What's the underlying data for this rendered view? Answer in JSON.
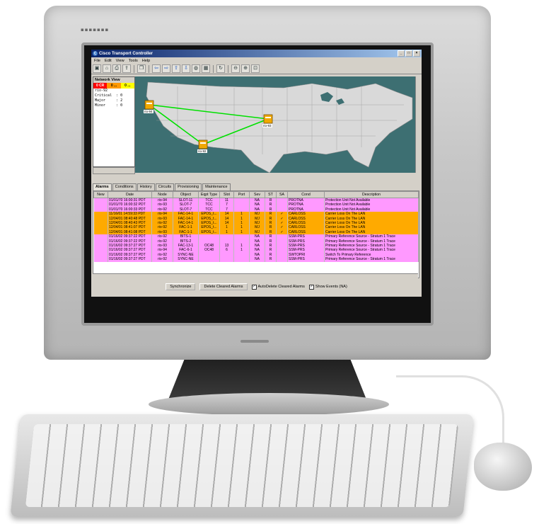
{
  "app": {
    "title": "Cisco Transport Controller",
    "window_controls": [
      "_",
      "□",
      "×"
    ]
  },
  "menu": [
    "File",
    "Edit",
    "View",
    "Tools",
    "Help"
  ],
  "network_view": {
    "title": "Network View",
    "severity": [
      {
        "label": "0 CR",
        "color": "#ff0000"
      },
      {
        "label": "0 ...",
        "color": "#ff9900"
      },
      {
        "label": "0 ...",
        "color": "#ffff00"
      }
    ],
    "lines": [
      "rio-92",
      "Critical  : 0",
      "Major     : 2",
      "Minor     : 0"
    ]
  },
  "map": {
    "water_color": "#3d6f72",
    "land_color": "#d9d9d9",
    "link_color": "#00e000",
    "nodes": [
      {
        "name": "rio-94"
      },
      {
        "name": "rio-93"
      },
      {
        "name": "rio-92"
      }
    ]
  },
  "tabs": [
    "Alarms",
    "Conditions",
    "History",
    "Circuits",
    "Provisioning",
    "Maintenance"
  ],
  "alarms": {
    "columns": [
      "New",
      "Date",
      "Node",
      "Object",
      "Eqpt Type",
      "Slot",
      "Port",
      "Sev",
      "ST",
      "SA",
      "Cond",
      "Description"
    ],
    "rows": [
      {
        "style": "pink",
        "cells": [
          "",
          "01/01/70 16:00:31 PDT",
          "rio-94",
          "SLOT-11",
          "TCC",
          "11",
          "",
          "NA",
          "R",
          "",
          "PROTNA",
          "Protection Unit Not Available"
        ]
      },
      {
        "style": "pink",
        "cells": [
          "",
          "01/01/70 16:00:32 PDT",
          "rio-93",
          "SLOT-7",
          "TCC",
          "7",
          "",
          "NA",
          "R",
          "",
          "PROTNA",
          "Protection Unit Not Available"
        ]
      },
      {
        "style": "pink",
        "cells": [
          "",
          "01/01/70 16:00:33 PDT",
          "rio-92",
          "SLOT-7",
          "TCC",
          "7",
          "",
          "NA",
          "R",
          "",
          "PROTNA",
          "Protection Unit Not Available"
        ]
      },
      {
        "style": "orange",
        "cells": [
          "",
          "11/16/01 14:59:33 PDT",
          "rio-94",
          "FAC-14-1",
          "EPOS_t...",
          "14",
          "1",
          "MJ",
          "R",
          "✓",
          "CARLOSS",
          "Carrier Loss On The LAN"
        ]
      },
      {
        "style": "orange",
        "cells": [
          "",
          "12/04/01 08:40:48 PDT",
          "rio-93",
          "FAC-14-1",
          "EPOS_t...",
          "14",
          "1",
          "MJ",
          "R",
          "✓",
          "CARLOSS",
          "Carrier Loss On The LAN"
        ]
      },
      {
        "style": "orange",
        "cells": [
          "",
          "12/04/01 08:40:43 PDT",
          "rio-92",
          "FAC-14-1",
          "EPOS_t...",
          "14",
          "1",
          "MJ",
          "R",
          "✓",
          "CARLOSS",
          "Carrier Loss On The LAN"
        ]
      },
      {
        "style": "orange",
        "cells": [
          "",
          "12/04/01 08:41:07 PDT",
          "rio-92",
          "FAC-1-1",
          "EPOS_t...",
          "1",
          "1",
          "MJ",
          "R",
          "✓",
          "CARLOSS",
          "Carrier Loss On The LAN"
        ]
      },
      {
        "style": "orange",
        "cells": [
          "",
          "12/04/01 08:41:08 PDT",
          "rio-93",
          "FAC-1-1",
          "EPOS_t...",
          "1",
          "1",
          "MJ",
          "R",
          "✓",
          "CARLOSS",
          "Carrier Loss On The LAN"
        ]
      },
      {
        "style": "pink",
        "cells": [
          "",
          "01/16/02 09:37:22 PDT",
          "rio-92",
          "BITS-1",
          "",
          "",
          "",
          "NA",
          "R",
          "",
          "SSM-PRS",
          "Primary Reference Source - Stratum 1 Trace"
        ]
      },
      {
        "style": "pink",
        "cells": [
          "",
          "01/16/02 09:37:22 PDT",
          "rio-92",
          "BITS-2",
          "",
          "",
          "",
          "NA",
          "R",
          "",
          "SSM-PRS",
          "Primary Reference Source - Stratum 1 Trace"
        ]
      },
      {
        "style": "pink",
        "cells": [
          "",
          "01/16/02 09:37:27 PDT",
          "rio-93",
          "FAC-13-1",
          "OC48",
          "13",
          "1",
          "NA",
          "R",
          "",
          "SSM-PRS",
          "Primary Reference Source - Stratum 1 Trace"
        ]
      },
      {
        "style": "pink",
        "cells": [
          "",
          "01/16/02 09:37:27 PDT",
          "rio-94",
          "FAC-6-1",
          "OC48",
          "6",
          "1",
          "NA",
          "R",
          "",
          "SSM-PRS",
          "Primary Reference Source - Stratum 1 Trace"
        ]
      },
      {
        "style": "pink",
        "cells": [
          "",
          "01/16/02 09:37:27 PDT",
          "rio-92",
          "SYNC-NE",
          "",
          "",
          "",
          "NA",
          "R",
          "",
          "SWTOPRI",
          "Switch To Primary Reference"
        ]
      },
      {
        "style": "pink",
        "cells": [
          "",
          "01/16/02 09:37:27 PDT",
          "rio-92",
          "SYNC-NE",
          "",
          "",
          "",
          "NA",
          "R",
          "",
          "SSM-PRS",
          "Primary Reference Source - Stratum 1 Trace"
        ]
      }
    ]
  },
  "bottom": {
    "synchronize": "Synchronize",
    "delete_cleared": "Delete Cleared Alarms",
    "autodelete": "AutoDelete Cleared Alarms",
    "autodelete_checked": true,
    "show_events": "Show Events (NA)",
    "show_events_checked": true
  }
}
